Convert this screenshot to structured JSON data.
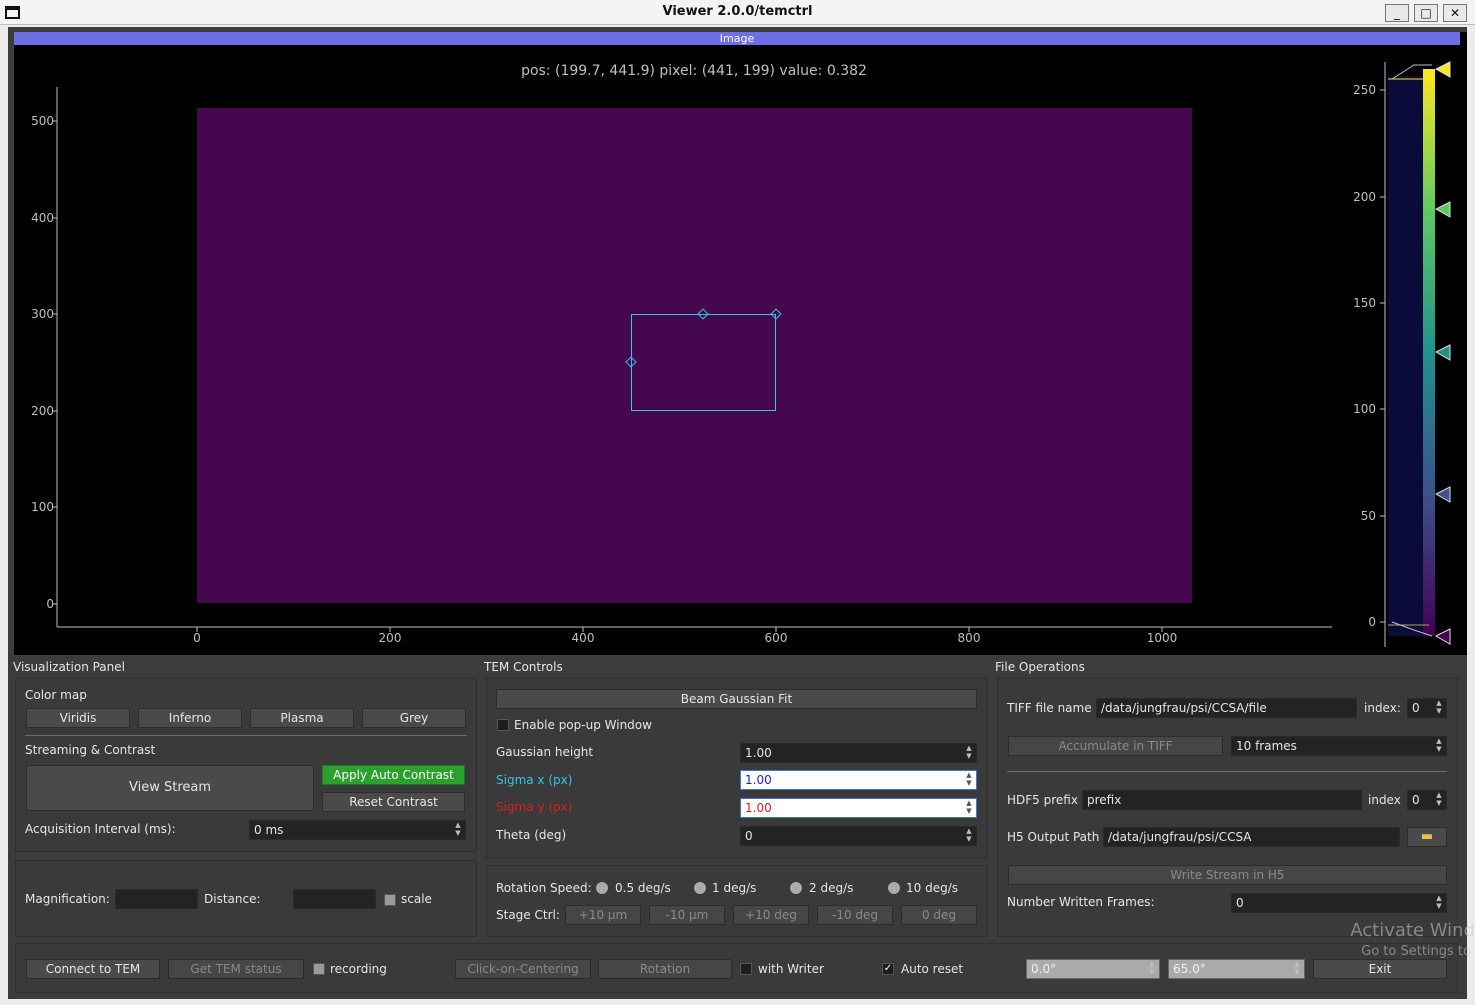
{
  "window": {
    "title": "Viewer 2.0.0/temctrl",
    "minimize": "_",
    "maximize": "□",
    "close": "✕"
  },
  "plot": {
    "header": "Image",
    "pos_text": "pos: (199.7, 441.9) pixel: (441, 199) value: 0.382",
    "y_ticks": [
      "500",
      "400",
      "300",
      "200",
      "100",
      "0"
    ],
    "x_ticks": [
      "0",
      "200",
      "400",
      "600",
      "800",
      "1000"
    ],
    "colorbar_ticks": [
      "250",
      "200",
      "150",
      "100",
      "50",
      "0"
    ]
  },
  "visualization": {
    "title": "Visualization Panel",
    "colormap_label": "Color map",
    "colormaps": [
      "Viridis",
      "Inferno",
      "Plasma",
      "Grey"
    ],
    "streaming_label": "Streaming & Contrast",
    "view_stream": "View Stream",
    "apply_auto_contrast": "Apply Auto Contrast",
    "reset_contrast": "Reset Contrast",
    "acq_label": "Acquisition Interval (ms):",
    "acq_value": "0 ms",
    "magnification_label": "Magnification:",
    "distance_label": "Distance:",
    "scale_label": "scale"
  },
  "tem": {
    "title": "TEM Controls",
    "beam_fit": "Beam Gaussian Fit",
    "popup_label": "Enable pop-up Window",
    "gaussian_height_label": "Gaussian height",
    "gaussian_height_value": "1.00",
    "sigma_x_label": "Sigma x (px)",
    "sigma_x_value": "1.00",
    "sigma_y_label": "Sigma y (px)",
    "sigma_y_value": "1.00",
    "theta_label": "Theta (deg)",
    "theta_value": "0",
    "rotation_speed_label": "Rotation Speed:",
    "speeds": [
      "0.5 deg/s",
      "1 deg/s",
      "2 deg/s",
      "10 deg/s"
    ],
    "stage_ctrl_label": "Stage Ctrl:",
    "stage_buttons": [
      "+10 µm",
      "-10 µm",
      "+10 deg",
      "-10 deg",
      "0 deg"
    ]
  },
  "file": {
    "title": "File Operations",
    "tiff_label": "TIFF file name",
    "tiff_value": "/data/jungfrau/psi/CCSA/file",
    "index_label": "index:",
    "index_value": "0",
    "accumulate": "Accumulate in TIFF",
    "frames_value": "10 frames",
    "hdf5_label": "HDF5 prefix",
    "hdf5_value": "prefix",
    "index2_label": "index",
    "index2_value": "0",
    "h5_path_label": "H5 Output Path",
    "h5_path_value": "/data/jungfrau/psi/CCSA",
    "write_stream": "Write Stream in H5",
    "written_frames_label": "Number Written Frames:",
    "written_frames_value": "0"
  },
  "bottom": {
    "connect": "Connect to TEM",
    "get_status": "Get TEM status",
    "recording": "recording",
    "click_centering": "Click-on-Centering",
    "rotation": "Rotation",
    "with_writer": "with Writer",
    "auto_reset": "Auto reset",
    "angle1": "0.0°",
    "angle2": "65.0°",
    "exit": "Exit"
  },
  "watermark": {
    "line1": "Activate Wind",
    "line2": "Go to Settings to"
  },
  "colors": {
    "image": "#45084f",
    "roi": "#33c5e8",
    "header": "#6e6ee6",
    "green": "#2ca02c"
  }
}
